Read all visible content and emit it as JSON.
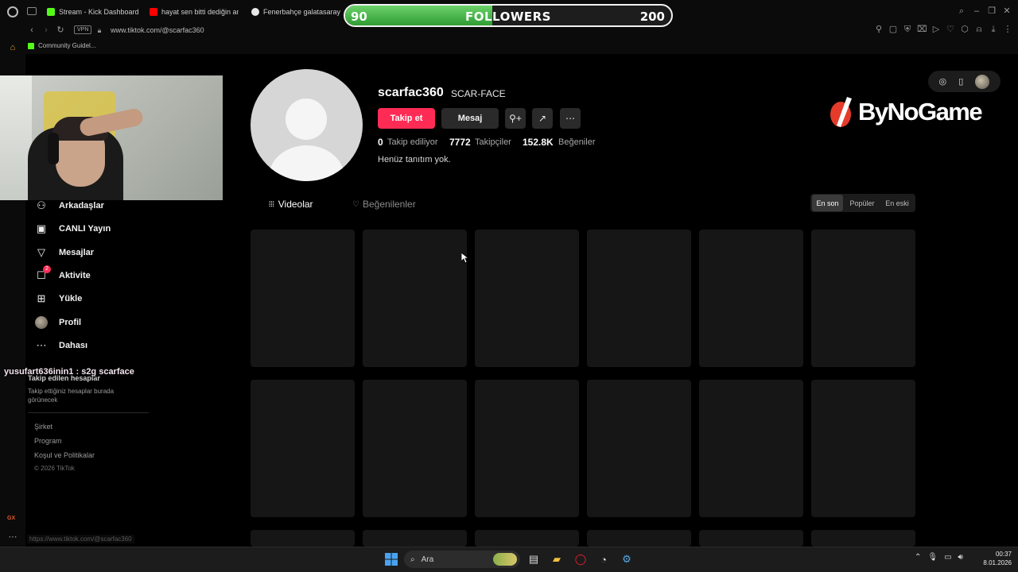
{
  "browser": {
    "tabs": [
      {
        "label": "Stream - Kick Dashboard",
        "favicon_color": "#53fc18"
      },
      {
        "label": "hayat sen bitti dediğin an g",
        "favicon_color": "#ff0000"
      },
      {
        "label": "Fenerbahçe galatasaray m",
        "favicon_color": "#e8e8e8"
      }
    ],
    "vpn_label": "VPN",
    "url": "www.tiktok.com/@scarfac360",
    "bookmark": "Community Guidel...",
    "status_url": "https://www.tiktok.com/@scarfac360",
    "rail_gx": "GX"
  },
  "overlay": {
    "followers_label": "FOLLOWERS",
    "current": "90",
    "goal": "200",
    "progress_fraction": 0.45,
    "chat_message": "yusufart636inin1 : s2g scarface",
    "brand": "ByNoGame"
  },
  "sidebar": {
    "items": [
      {
        "label": "Arkadaşlar",
        "icon": "friends-icon"
      },
      {
        "label": "CANLI Yayın",
        "icon": "live-icon"
      },
      {
        "label": "Mesajlar",
        "icon": "messages-icon"
      },
      {
        "label": "Aktivite",
        "icon": "activity-icon",
        "badge": "2"
      },
      {
        "label": "Yükle",
        "icon": "upload-icon"
      },
      {
        "label": "Profil",
        "icon": "profile-avatar"
      },
      {
        "label": "Dahası",
        "icon": "more-icon"
      }
    ],
    "following_title": "Takip edilen hesaplar",
    "following_hint": "Takip ettiğiniz hesaplar burada görünecek",
    "links": [
      "Şirket",
      "Program",
      "Koşul ve Politikalar"
    ],
    "copyright": "© 2026 TikTok"
  },
  "profile": {
    "username": "scarfac360",
    "display_name": "SCAR-FACE",
    "follow_button": "Takip et",
    "message_button": "Mesaj",
    "following_count": "0",
    "following_label": "Takip ediliyor",
    "followers_count": "7772",
    "followers_label": "Takipçiler",
    "likes_count": "152.8K",
    "likes_label": "Beğeniler",
    "bio": "Henüz tanıtım yok.",
    "tabs": [
      "Videolar",
      "Beğenilenler"
    ],
    "sort_options": [
      "En son",
      "Popüler",
      "En eski"
    ],
    "selected_sort": "En son"
  },
  "taskbar": {
    "search_placeholder": "Ara",
    "time": "00:37",
    "date": "8.01.2026"
  },
  "colors": {
    "accent": "#fe2c55",
    "progress_green": "#3fae3c",
    "brand_red": "#e43b2a"
  }
}
